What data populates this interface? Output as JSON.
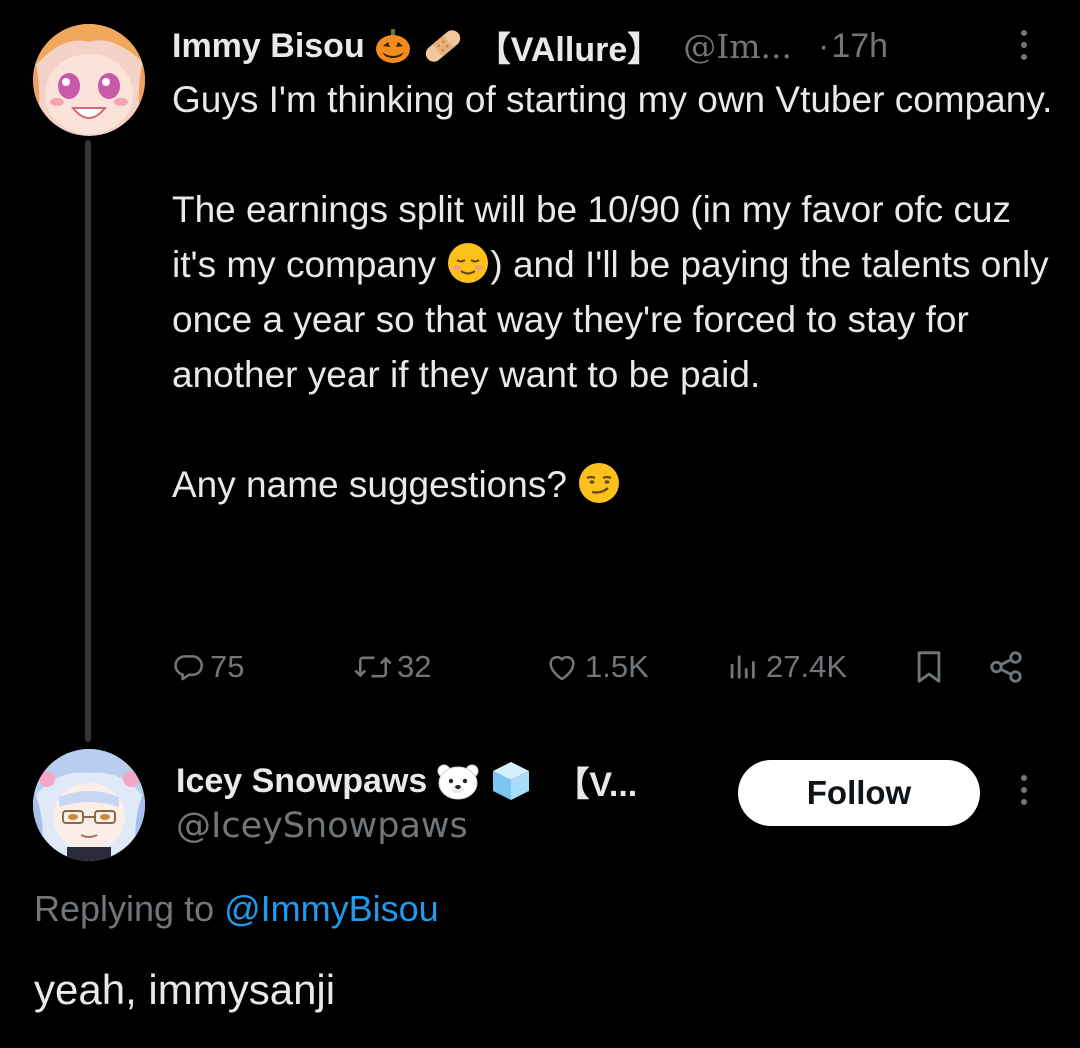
{
  "tweet": {
    "author": {
      "display_name": "Immy Bisou",
      "badges": [
        "pumpkin-emoji",
        "bandage-emoji"
      ],
      "name_tag": "【VAllure】",
      "handle": "@Im...",
      "separator": "·",
      "time": "17h"
    },
    "text": {
      "line1": "Guys I'm thinking of starting my own Vtuber company.",
      "para2_part1": "The earnings split will be 10/90 (in my favor ofc cuz it's my company ",
      "para2_emoji": "relieved-face-emoji",
      "para2_part2": ") and I'll be paying the talents only once a year so that way they're forced to stay for another year if they want to be paid.",
      "para3": "Any name suggestions? ",
      "para3_emoji": "smirking-face-emoji"
    },
    "stats": {
      "replies": "75",
      "retweets": "32",
      "likes": "1.5K",
      "views": "27.4K"
    }
  },
  "reply": {
    "author": {
      "display_name": "Icey Snowpaws",
      "badges": [
        "polar-bear-emoji",
        "ice-cube-emoji"
      ],
      "name_tag": "【V...",
      "handle": "@IceySnowpaws"
    },
    "follow_label": "Follow",
    "replying_to_prefix": "Replying to ",
    "replying_to_mention": "@ImmyBisou",
    "text": "yeah, immysanji"
  },
  "colors": {
    "background": "#000000",
    "text_primary": "#e7e9ea",
    "text_secondary": "#71767b",
    "link": "#1d9bf0",
    "thread_line": "#333639",
    "follow_button_bg": "#ffffff"
  }
}
